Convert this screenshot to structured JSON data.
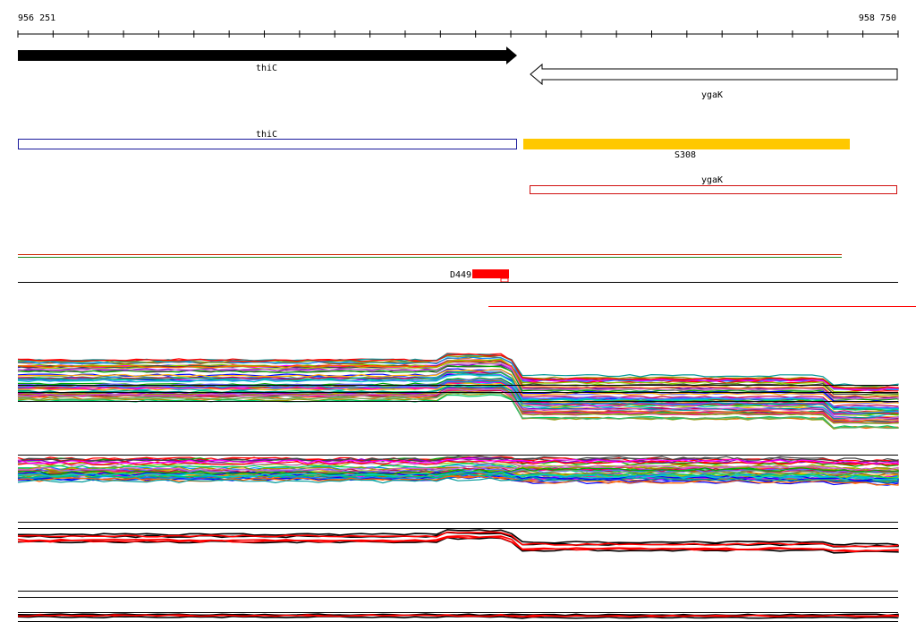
{
  "ruler": {
    "start_label": "956 251",
    "end_label": "958 750"
  },
  "genes": [
    {
      "name": "thiC",
      "strand": "+"
    },
    {
      "name": "ygaK",
      "strand": "-"
    }
  ],
  "features": [
    {
      "label": "thiC",
      "kind": "gene-outline",
      "color": "#1a1a9c"
    },
    {
      "label": "S308",
      "kind": "filled-block",
      "color": "#ffc800"
    },
    {
      "label": "ygaK",
      "kind": "gene-outline",
      "color": "#d01010"
    }
  ],
  "marker": {
    "label": "D449",
    "color": "#ff0000"
  },
  "colors": {
    "gene_forward": "#000000",
    "accent_red": "#ff0000",
    "accent_orange": "#ffc800"
  }
}
